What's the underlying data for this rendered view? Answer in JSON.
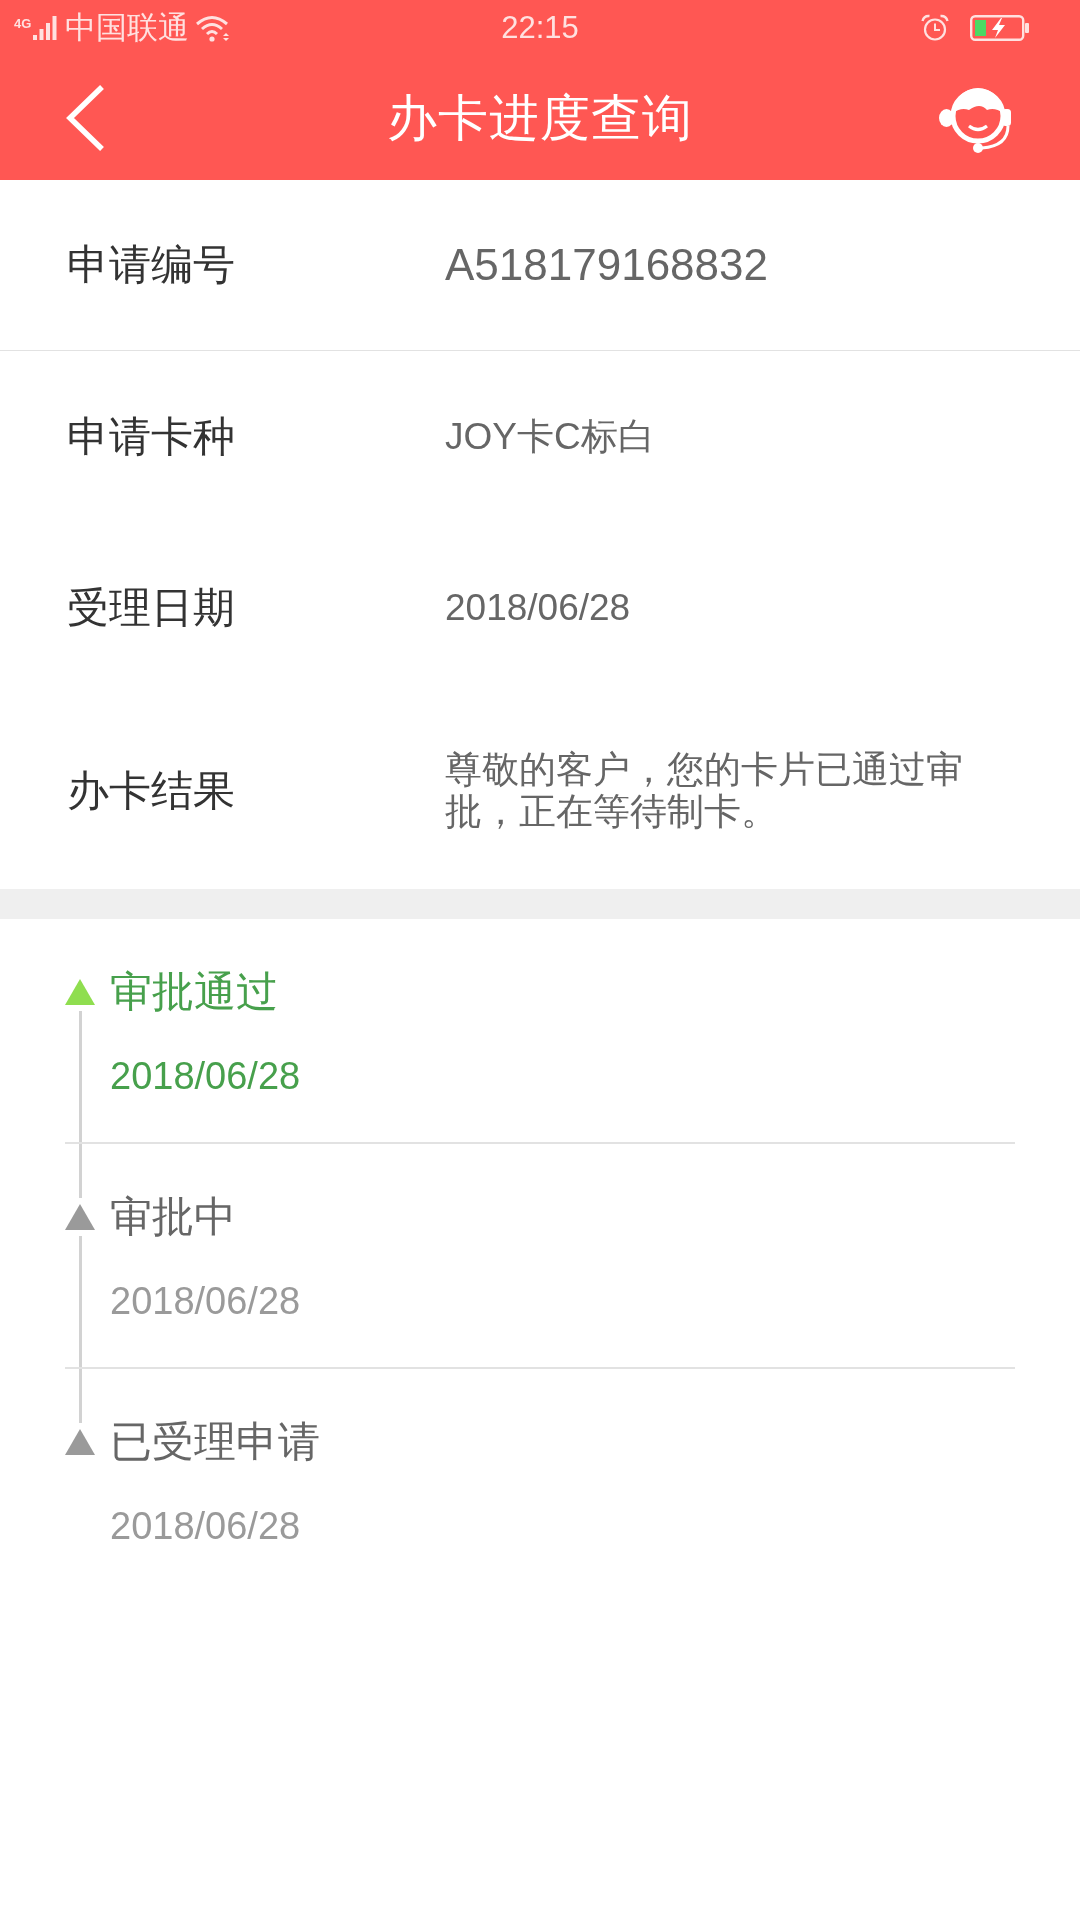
{
  "status_bar": {
    "network": "4G",
    "carrier": "中国联通",
    "time": "22:15"
  },
  "header": {
    "title": "办卡进度查询"
  },
  "details": [
    {
      "label": "申请编号",
      "value": "A518179168832",
      "kind": "code"
    },
    {
      "label": "申请卡种",
      "value": "JOY卡C标白",
      "kind": "text"
    },
    {
      "label": "受理日期",
      "value": "2018/06/28",
      "kind": "text"
    },
    {
      "label": "办卡结果",
      "value": "尊敬的客户，您的卡片已通过审批，正在等待制卡。",
      "kind": "text"
    }
  ],
  "steps": [
    {
      "title": "审批通过",
      "date": "2018/06/28",
      "current": true
    },
    {
      "title": "审批中",
      "date": "2018/06/28",
      "current": false
    },
    {
      "title": "已受理申请",
      "date": "2018/06/28",
      "current": false
    }
  ]
}
